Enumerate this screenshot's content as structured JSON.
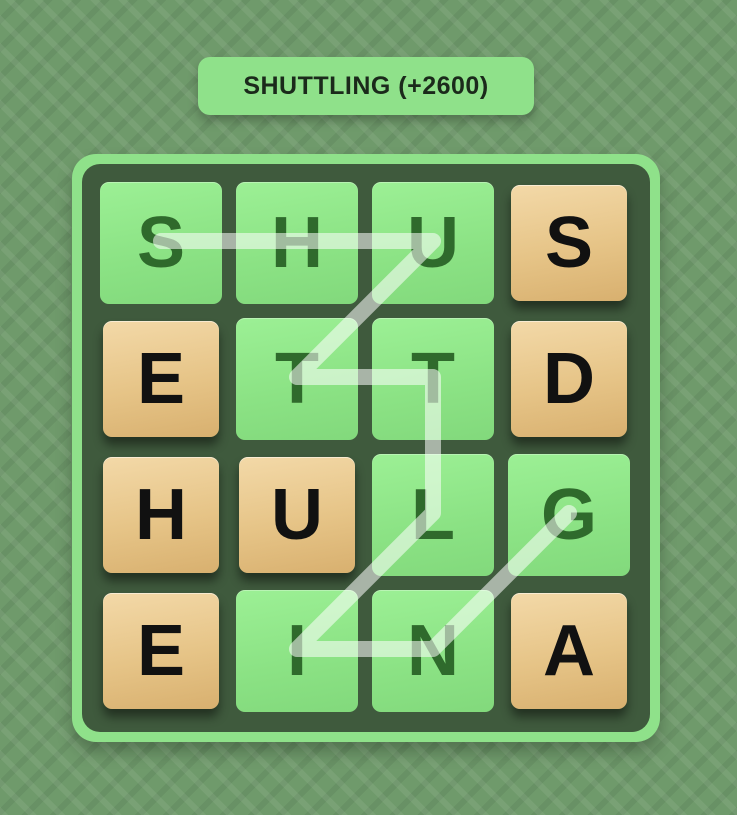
{
  "banner": {
    "text": "SHUTTLING (+2600)"
  },
  "board": {
    "rows": [
      [
        {
          "letter": "S",
          "state": "selected"
        },
        {
          "letter": "H",
          "state": "selected"
        },
        {
          "letter": "U",
          "state": "selected"
        },
        {
          "letter": "S",
          "state": "unselected"
        }
      ],
      [
        {
          "letter": "E",
          "state": "unselected"
        },
        {
          "letter": "T",
          "state": "selected"
        },
        {
          "letter": "T",
          "state": "selected"
        },
        {
          "letter": "D",
          "state": "unselected"
        }
      ],
      [
        {
          "letter": "H",
          "state": "unselected"
        },
        {
          "letter": "U",
          "state": "unselected"
        },
        {
          "letter": "L",
          "state": "selected"
        },
        {
          "letter": "G",
          "state": "selected"
        }
      ],
      [
        {
          "letter": "E",
          "state": "unselected"
        },
        {
          "letter": "I",
          "state": "selected"
        },
        {
          "letter": "N",
          "state": "selected"
        },
        {
          "letter": "A",
          "state": "unselected"
        }
      ]
    ],
    "path": [
      [
        0,
        0
      ],
      [
        0,
        1
      ],
      [
        0,
        2
      ],
      [
        1,
        1
      ],
      [
        1,
        2
      ],
      [
        2,
        2
      ],
      [
        3,
        1
      ],
      [
        3,
        2
      ],
      [
        2,
        3
      ]
    ]
  },
  "colors": {
    "selected_tile": "#8be284",
    "selected_letter": "#2f6a2c",
    "wood_tile": "#e6c487",
    "board_background": "#3f5a3d",
    "banner": "#8fe18a",
    "path_stroke": "#ffffff"
  }
}
